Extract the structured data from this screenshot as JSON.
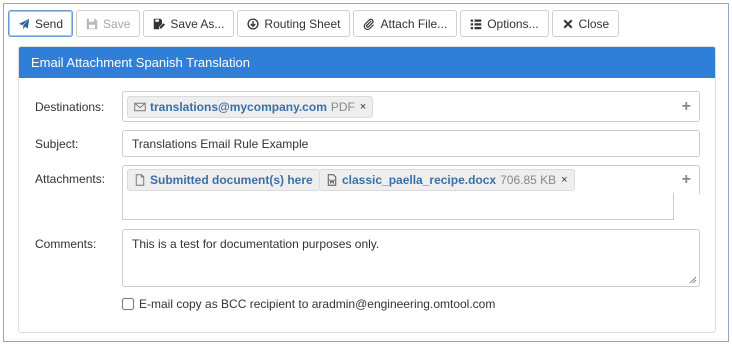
{
  "toolbar": {
    "send": "Send",
    "save": "Save",
    "save_as": "Save As...",
    "routing_sheet": "Routing Sheet",
    "attach_file": "Attach File...",
    "options": "Options...",
    "close": "Close"
  },
  "panel": {
    "title": "Email Attachment Spanish Translation"
  },
  "form": {
    "destinations_label": "Destinations:",
    "destination": {
      "address": "translations@mycompany.com",
      "format": "PDF",
      "remove": "×"
    },
    "subject_label": "Subject:",
    "subject_value": "Translations Email Rule Example",
    "attachments_label": "Attachments:",
    "attachments": [
      {
        "name": "Submitted document(s) here"
      },
      {
        "name": "classic_paella_recipe.docx",
        "size": "706.85 KB",
        "remove": "×"
      }
    ],
    "comments_label": "Comments:",
    "comments_value": "This is a test for documentation purposes only.",
    "bcc_label": "E-mail copy as BCC recipient to aradmin@engineering.omtool.com",
    "add_symbol": "+"
  },
  "colors": {
    "header_bg": "#2f7fd8",
    "link_text": "#3b6fa9",
    "frame_border": "#8fa7c9"
  },
  "icons": {
    "send": "paper-plane-icon",
    "save": "floppy-disk-icon",
    "save_as": "floppy-pencil-icon",
    "routing_sheet": "circle-arrow-down-icon",
    "attach_file": "paperclip-icon",
    "options": "list-icon",
    "close": "x-icon",
    "destination": "envelope-icon",
    "attachment_doc": "document-icon",
    "attachment_word": "word-document-icon"
  }
}
